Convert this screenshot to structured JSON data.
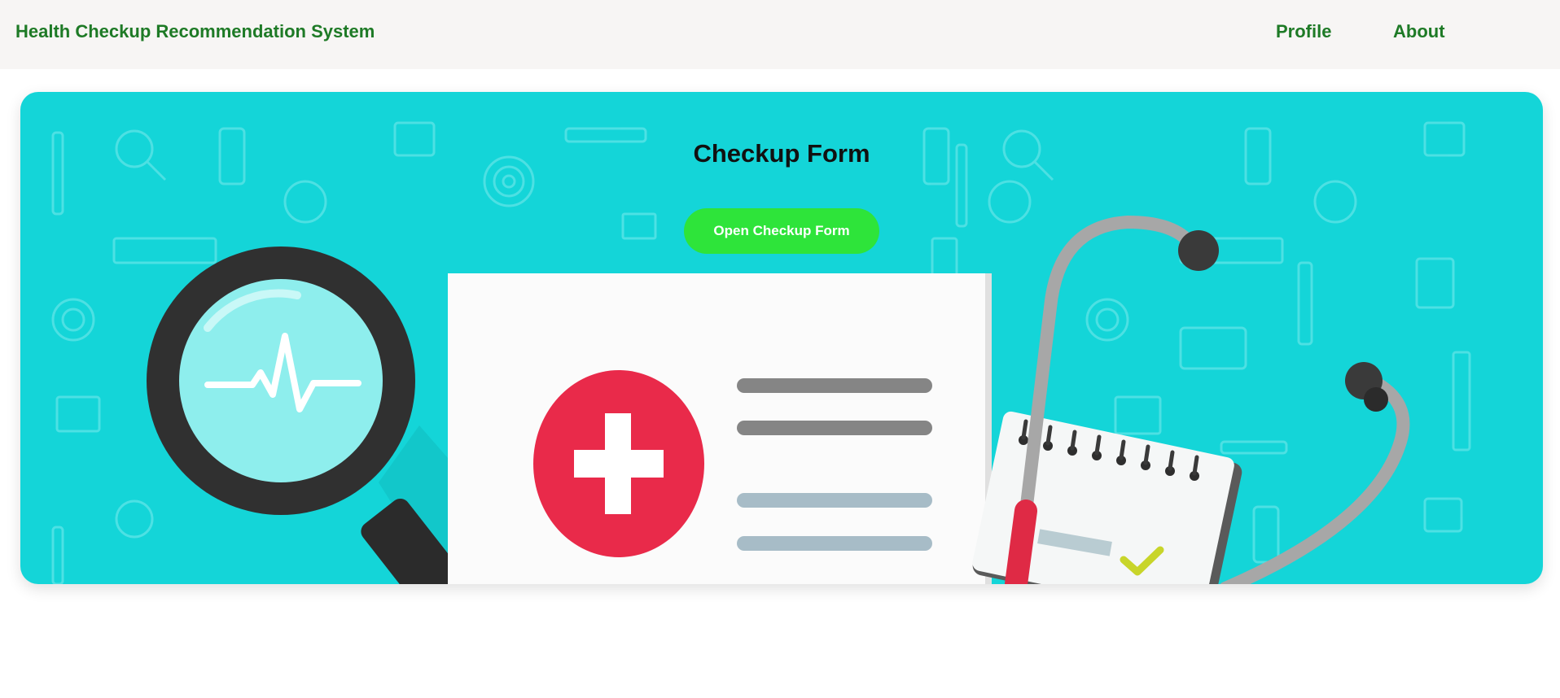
{
  "navbar": {
    "brand": "Health Checkup Recommendation System",
    "links": [
      {
        "label": "Profile"
      },
      {
        "label": "About"
      }
    ]
  },
  "hero": {
    "title": "Checkup Form",
    "button_label": "Open Checkup Form",
    "illustration_icons": [
      "magnifier-heartbeat-icon",
      "medical-document-icon",
      "red-cross-icon",
      "notepad-icon",
      "stethoscope-icon",
      "checkmark-icon"
    ]
  },
  "colors": {
    "brand_green": "#1e7a26",
    "navbar_bg": "#f7f5f4",
    "hero_bg": "#14d5d8",
    "button_green": "#2ee43a",
    "cross_red": "#e92a4a"
  }
}
